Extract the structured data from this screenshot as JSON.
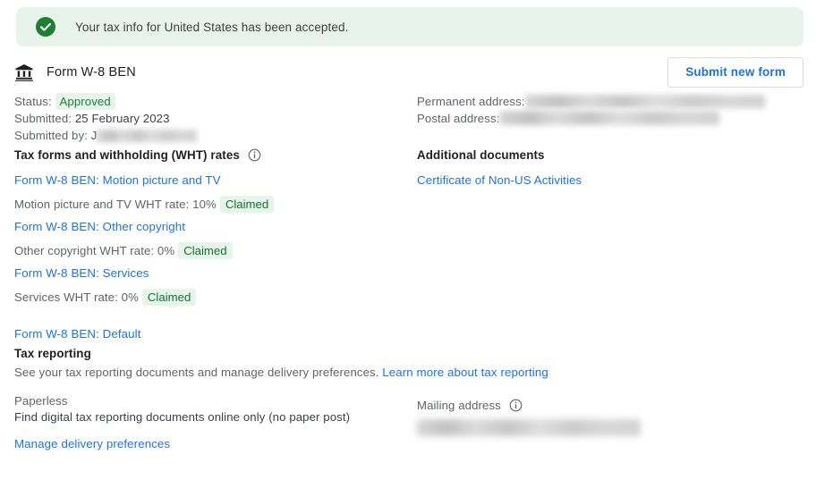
{
  "banner": {
    "icon": "check-circle-icon",
    "message": "Your tax info for United States has been accepted."
  },
  "header": {
    "icon": "account-balance-icon",
    "title": "Form W-8 BEN",
    "submit_button_label": "Submit new form"
  },
  "details": {
    "status_label": "Status:",
    "status_value": "Approved",
    "submitted_label": "Submitted:",
    "submitted_value": "25 February 2023",
    "submitted_by_label": "Submitted by:",
    "submitted_by_value": "J",
    "permanent_address_label": "Permanent address:",
    "permanent_address_value": "",
    "postal_address_label": "Postal address:",
    "postal_address_value": ""
  },
  "tax_forms": {
    "heading": "Tax forms and withholding (WHT) rates",
    "info_icon": "info-icon",
    "entries": [
      {
        "link": "Form W-8 BEN: Motion picture and TV",
        "rate_text": "Motion picture and TV WHT rate: 10%",
        "badge": "Claimed"
      },
      {
        "link": "Form W-8 BEN: Other copyright",
        "rate_text": "Other copyright WHT rate: 0%",
        "badge": "Claimed"
      },
      {
        "link": "Form W-8 BEN: Services",
        "rate_text": "Services WHT rate: 0%",
        "badge": "Claimed"
      }
    ],
    "default_link": "Form W-8 BEN: Default"
  },
  "additional_documents": {
    "heading": "Additional documents",
    "links": [
      "Certificate of Non-US Activities"
    ]
  },
  "tax_reporting": {
    "title": "Tax reporting",
    "description": "See your tax reporting documents and manage delivery preferences.",
    "learn_more_link": "Learn more about tax reporting",
    "paperless_label": "Paperless",
    "paperless_description": "Find digital tax reporting documents online only (no paper post)",
    "manage_link": "Manage delivery preferences",
    "mailing_address_label": "Mailing address",
    "mailing_address_info_icon": "info-icon",
    "mailing_address_value": ""
  },
  "colors": {
    "banner_bg": "#e8f3ec",
    "success_green": "#1e7e34",
    "badge_bg": "#e6f4ea",
    "badge_text": "#137333",
    "link_blue": "#1a73e8",
    "text_primary": "#202124",
    "text_secondary": "#5f6368"
  }
}
